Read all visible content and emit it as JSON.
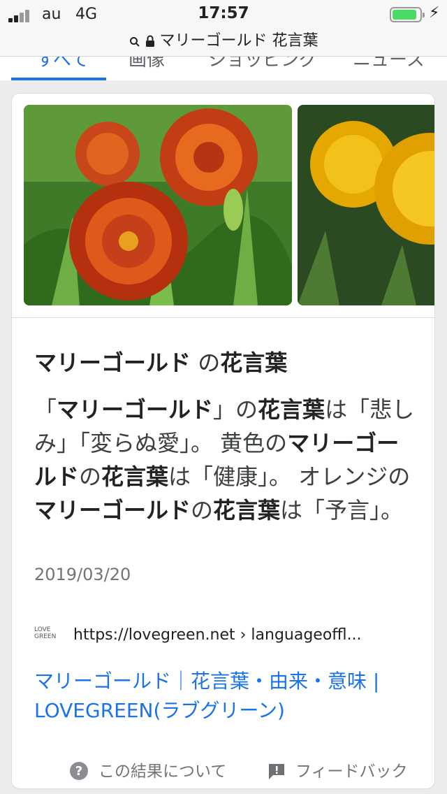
{
  "status": {
    "carrier": "au",
    "network": "4G",
    "time": "17:57",
    "bolt": "⚡"
  },
  "url": {
    "text": "マリーゴールド 花言葉"
  },
  "tabs": [
    {
      "label": "すべて"
    },
    {
      "label": "画像"
    },
    {
      "label": "ショッピング"
    },
    {
      "label": "ニュース"
    }
  ],
  "result": {
    "title_term": "マリーゴールド",
    "title_mid": "の",
    "title_term2": "花言葉",
    "snippet": [
      {
        "t": "「",
        "b": false
      },
      {
        "t": "マリーゴールド",
        "b": true
      },
      {
        "t": "」の",
        "b": false
      },
      {
        "t": "花言葉",
        "b": true
      },
      {
        "t": "は「悲しみ」「変らぬ愛」。 黄色の",
        "b": false
      },
      {
        "t": "マリーゴールド",
        "b": true
      },
      {
        "t": "の",
        "b": false
      },
      {
        "t": "花言葉",
        "b": true
      },
      {
        "t": "は「健康」。 オレンジの",
        "b": false
      },
      {
        "t": "マリーゴールド",
        "b": true
      },
      {
        "t": "の",
        "b": false
      },
      {
        "t": "花言葉",
        "b": true
      },
      {
        "t": "は「予言」。",
        "b": false
      }
    ],
    "date": "2019/03/20",
    "favicon_text": "LOVE GREEN",
    "source_url": "https://lovegreen.net › languageoffl...",
    "link_title": "マリーゴールド｜花言葉・由来・意味 | LOVEGREEN(ラブグリーン)"
  },
  "footer": {
    "about": "この結果について",
    "feedback": "フィードバック"
  },
  "colors": {
    "accent": "#1a73e8",
    "battery": "#4cd964"
  }
}
